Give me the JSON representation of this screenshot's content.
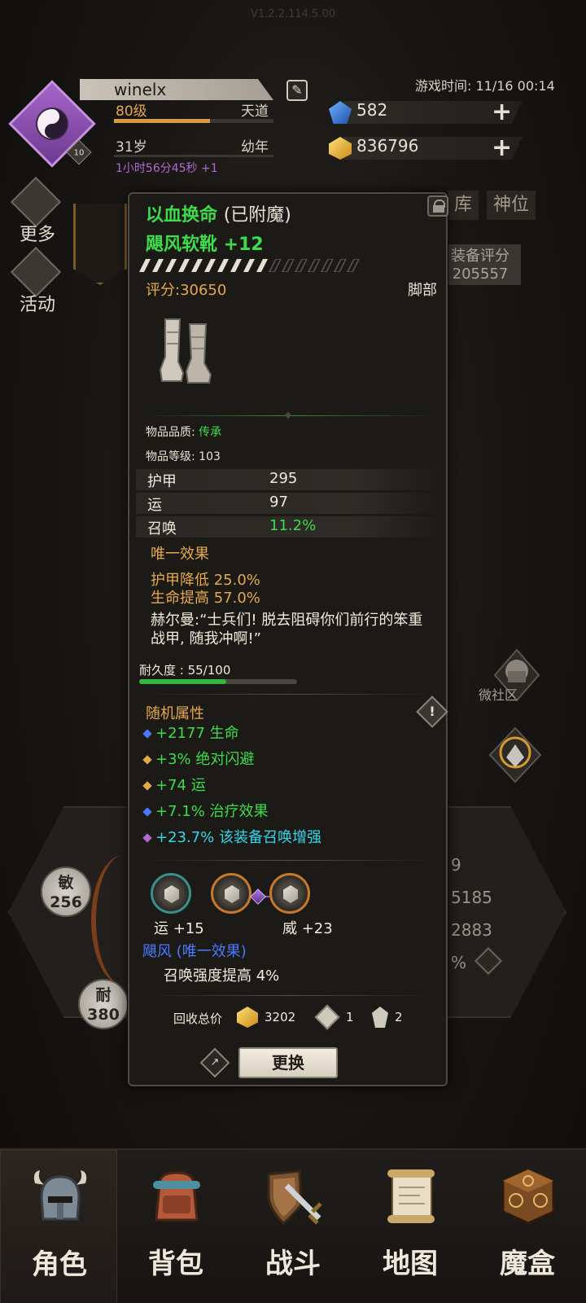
{
  "header": {
    "version": "V1.2.2.114.5.00",
    "player_name": "winelx",
    "level": "80级",
    "path": "天道",
    "xp_fraction": 0.6,
    "age": "31岁",
    "age_stage": "幼年",
    "timer": "1小时56分45秒 +1",
    "avatar_badge": "10",
    "game_time": "游戏时间: 11/16 00:14",
    "crystals": "582",
    "gold": "836796"
  },
  "side_buttons": [
    {
      "label": "更多",
      "icon": "arrow-down-icon"
    },
    {
      "label": "活动",
      "icon": "drum-icon"
    }
  ],
  "background": {
    "tab_warehouse": "库",
    "tab_divine": "神位",
    "equip_score_label": "装备评分",
    "equip_score_value": "205557",
    "community_label": "微社区",
    "stat_agility_label": "敏",
    "stat_agility_value": "256",
    "stat_endurance_label": "耐",
    "stat_endurance_value": "380",
    "num_a": "9",
    "num_b": "5185",
    "num_c": "2883",
    "num_d": "%"
  },
  "item": {
    "enchant_name": "以血换命",
    "enchant_status": "(已附魔)",
    "name": "飓风软靴 +12",
    "score": "评分:30650",
    "slot": "脚部",
    "quality_label": "物品品质: ",
    "quality_value": "传承",
    "item_level": "物品等级: 103",
    "stats": [
      {
        "key": "护甲",
        "value": "295",
        "green": false
      },
      {
        "key": "运",
        "value": "97",
        "green": false
      },
      {
        "key": "召唤",
        "value": "11.2%",
        "green": true
      }
    ],
    "unique_title": "唯一效果",
    "unique_effects": [
      "护甲降低 25.0%",
      "生命提高 57.0%"
    ],
    "quote": "赫尔曼:“士兵们! 脱去阻碍你们前行的笨重战甲, 随我冲啊!”",
    "durability_label": "耐久度 : 55/100",
    "durability_fraction": 0.55,
    "random_title": "随机属性",
    "random_attrs": [
      {
        "text": "+2177 生命",
        "bullet_color": "#4a78ff",
        "cyan": false
      },
      {
        "text": "+3% 绝对闪避",
        "bullet_color": "#e6a84a",
        "cyan": false
      },
      {
        "text": "+74 运",
        "bullet_color": "#e6a84a",
        "cyan": false
      },
      {
        "text": "+7.1% 治疗效果",
        "bullet_color": "#4a78ff",
        "cyan": false
      },
      {
        "text": "+23.7% 该装备召唤增强",
        "bullet_color": "#b06ad0",
        "cyan": true
      }
    ],
    "gems": [
      {
        "label": "运 +15"
      },
      {
        "label": "威 +23"
      }
    ],
    "set_title": "飓风 (唯一效果)",
    "set_effect": "召唤强度提高 4%",
    "recycle_label": "回收总价",
    "recycle_gold": "3202",
    "recycle_stone": "1",
    "recycle_shard": "2",
    "swap_label": "更换"
  },
  "nav": [
    {
      "label": "角色",
      "icon": "helmet-icon",
      "active": true
    },
    {
      "label": "背包",
      "icon": "backpack-icon",
      "active": false
    },
    {
      "label": "战斗",
      "icon": "sword-shield-icon",
      "active": false
    },
    {
      "label": "地图",
      "icon": "scroll-map-icon",
      "active": false
    },
    {
      "label": "魔盒",
      "icon": "magic-box-icon",
      "active": false
    }
  ],
  "colors": {
    "green": "#3ddc4a",
    "gold": "#e6a84a",
    "cyan": "#33d6e8",
    "blue": "#4a78ff",
    "purple": "#b06ad0"
  }
}
